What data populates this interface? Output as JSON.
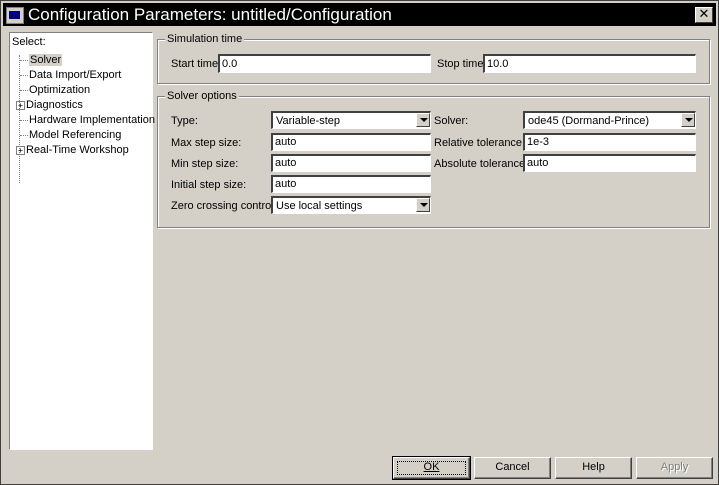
{
  "window": {
    "title": "Configuration Parameters: untitled/Configuration",
    "close_glyph": "✕"
  },
  "tree": {
    "header": "Select:",
    "items": [
      {
        "label": "Solver",
        "expandable": false,
        "selected": true
      },
      {
        "label": "Data Import/Export",
        "expandable": false,
        "selected": false
      },
      {
        "label": "Optimization",
        "expandable": false,
        "selected": false
      },
      {
        "label": "Diagnostics",
        "expandable": true,
        "selected": false
      },
      {
        "label": "Hardware Implementation",
        "expandable": false,
        "selected": false
      },
      {
        "label": "Model Referencing",
        "expandable": false,
        "selected": false
      },
      {
        "label": "Real-Time Workshop",
        "expandable": true,
        "selected": false
      }
    ]
  },
  "simulation_time": {
    "title": "Simulation time",
    "start_label": "Start time:",
    "start_value": "0.0",
    "stop_label": "Stop time:",
    "stop_value": "10.0"
  },
  "solver_options": {
    "title": "Solver options",
    "type_label": "Type:",
    "type_value": "Variable-step",
    "solver_label": "Solver:",
    "solver_value": "ode45 (Dormand-Prince)",
    "max_step_label": "Max step size:",
    "max_step_value": "auto",
    "rel_tol_label": "Relative tolerance:",
    "rel_tol_value": "1e-3",
    "min_step_label": "Min step size:",
    "min_step_value": "auto",
    "abs_tol_label": "Absolute tolerance:",
    "abs_tol_value": "auto",
    "init_step_label": "Initial step size:",
    "init_step_value": "auto",
    "zero_cross_label": "Zero crossing control:",
    "zero_cross_value": "Use local settings"
  },
  "buttons": {
    "ok": "OK",
    "cancel": "Cancel",
    "help": "Help",
    "apply": "Apply"
  },
  "icons": {
    "app": "simulink-window-icon",
    "close": "close-icon",
    "expand": "plus-expander-icon",
    "dropdown": "chevron-down-icon"
  }
}
